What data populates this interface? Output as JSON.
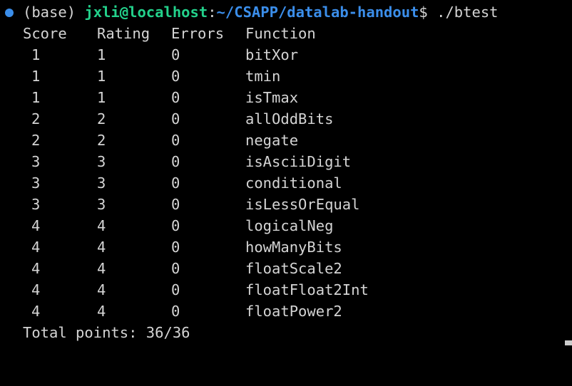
{
  "prompt": {
    "env": "(base)",
    "user_host": "jxli@localhost",
    "separator": ":",
    "cwd": "~/CSAPP/datalab-handout",
    "symbol": "$",
    "command": " ./btest"
  },
  "table": {
    "headers": {
      "score": "Score",
      "rating": "Rating",
      "errors": "Errors",
      "function": "Function"
    },
    "rows": [
      {
        "score": "1",
        "rating": "1",
        "errors": "0",
        "function": "bitXor"
      },
      {
        "score": "1",
        "rating": "1",
        "errors": "0",
        "function": "tmin"
      },
      {
        "score": "1",
        "rating": "1",
        "errors": "0",
        "function": "isTmax"
      },
      {
        "score": "2",
        "rating": "2",
        "errors": "0",
        "function": "allOddBits"
      },
      {
        "score": "2",
        "rating": "2",
        "errors": "0",
        "function": "negate"
      },
      {
        "score": "3",
        "rating": "3",
        "errors": "0",
        "function": "isAsciiDigit"
      },
      {
        "score": "3",
        "rating": "3",
        "errors": "0",
        "function": "conditional"
      },
      {
        "score": "3",
        "rating": "3",
        "errors": "0",
        "function": "isLessOrEqual"
      },
      {
        "score": "4",
        "rating": "4",
        "errors": "0",
        "function": "logicalNeg"
      },
      {
        "score": "4",
        "rating": "4",
        "errors": "0",
        "function": "howManyBits"
      },
      {
        "score": "4",
        "rating": "4",
        "errors": "0",
        "function": "floatScale2"
      },
      {
        "score": "4",
        "rating": "4",
        "errors": "0",
        "function": "floatFloat2Int"
      },
      {
        "score": "4",
        "rating": "4",
        "errors": "0",
        "function": "floatPower2"
      }
    ]
  },
  "total": "Total points: 36/36",
  "colors": {
    "background": "#000000",
    "text": "#d4d4d4",
    "user_host": "#23d18b",
    "cwd": "#3b8eea",
    "prompt_dot": "#3b8eea"
  }
}
